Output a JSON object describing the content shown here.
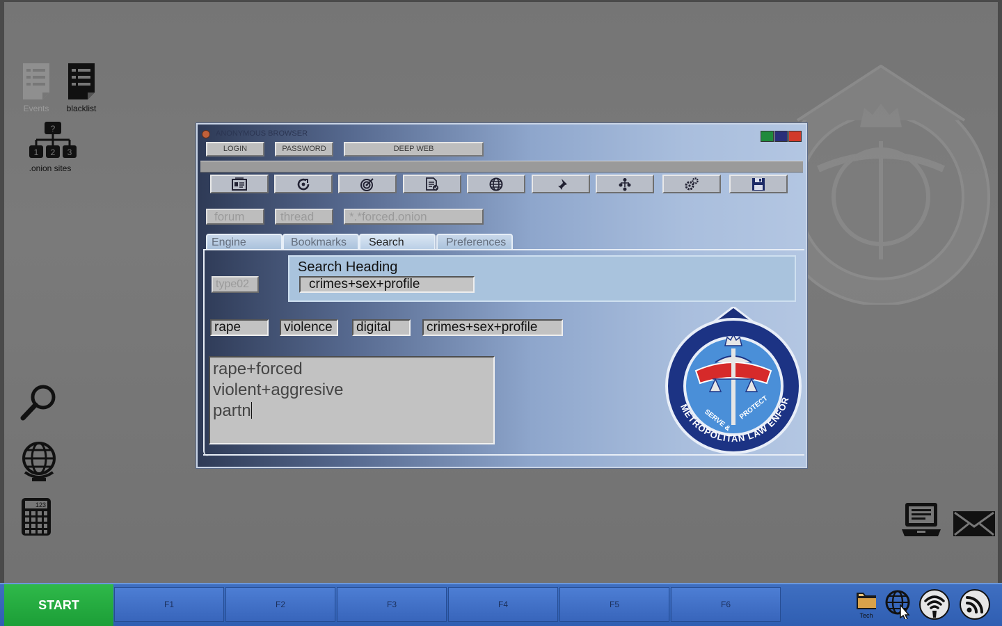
{
  "desktop": {
    "icons": [
      {
        "name": "events-icon",
        "label": "Events"
      },
      {
        "name": "blacklist-icon",
        "label": "blacklist"
      },
      {
        "name": "onion-sites-icon",
        "label": ".onion sites"
      }
    ],
    "sitemap_digits": [
      "?",
      "1",
      "2",
      "3"
    ],
    "calculator_display": "123"
  },
  "window": {
    "title": "ANONYMOUS BROWSER",
    "control_colors": [
      "#1f8a3c",
      "#2a2f7a",
      "#d23a2a"
    ],
    "login_label": "LOGIN",
    "password_label": "PASSWORD",
    "deepweb_label": "DEEP WEB",
    "fields": {
      "forum": "forum",
      "thread": "thread",
      "url": "*.*forced.onion"
    },
    "tabs": [
      {
        "label": "Engine"
      },
      {
        "label": "Bookmarks"
      },
      {
        "label": "Search"
      },
      {
        "label": "Preferences"
      }
    ],
    "type_field": "type02",
    "search_heading": "Search Heading",
    "search_heading_value": "crimes+sex+profile",
    "keywords": [
      "rape",
      "violence",
      "digital",
      "crimes+sex+profile"
    ],
    "text_lines": [
      "rape+forced",
      "violent+aggresive",
      "partn"
    ]
  },
  "seal": {
    "name": "METROPOLITAN LAW ENFORCEMENT",
    "motto_left": "SERVE &",
    "motto_right": "PROTECT"
  },
  "taskbar": {
    "start_label": "START",
    "fkeys": [
      "F1",
      "F2",
      "F3",
      "F4",
      "F5",
      "F6"
    ],
    "tray_tech_label": "Tech"
  },
  "colors": {
    "start": "#1fa83c",
    "taskbar": "#3565b8"
  }
}
